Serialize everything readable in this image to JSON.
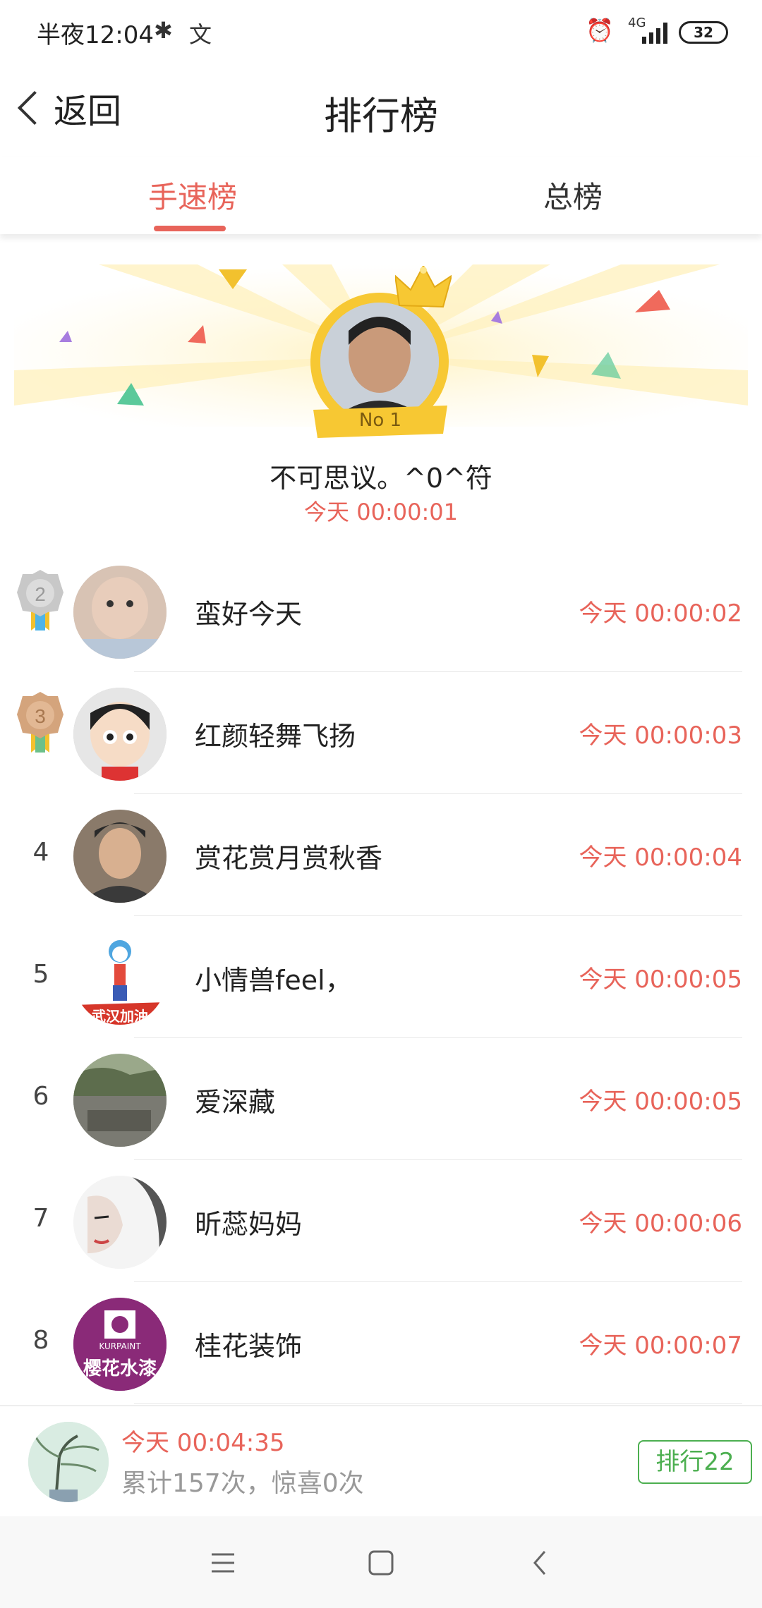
{
  "status_bar": {
    "time": "半夜12:04",
    "network": "4G",
    "battery": "32",
    "icons": [
      "bluetooth-icon",
      "app-notification-icon",
      "alarm-icon",
      "signal-icon",
      "battery-icon"
    ]
  },
  "header": {
    "back_label": "返回",
    "title": "排行榜"
  },
  "tabs": [
    {
      "label": "手速榜",
      "active": true
    },
    {
      "label": "总榜",
      "active": false
    }
  ],
  "winner": {
    "badge": "No 1",
    "name": "不可思议。^0^符",
    "time": "今天 00:00:01"
  },
  "rows": [
    {
      "rank": "2",
      "medal": "silver",
      "name": "蛮好今天",
      "time": "今天 00:00:02"
    },
    {
      "rank": "3",
      "medal": "bronze",
      "name": "红颜轻舞飞扬",
      "time": "今天 00:00:03"
    },
    {
      "rank": "4",
      "name": "赏花赏月赏秋香",
      "time": "今天 00:00:04"
    },
    {
      "rank": "5",
      "name": "小情兽feel，",
      "time": "今天 00:00:05",
      "avatar_text": "武汉加油"
    },
    {
      "rank": "6",
      "name": "爱深藏",
      "time": "今天 00:00:05"
    },
    {
      "rank": "7",
      "name": "昕蕊妈妈",
      "time": "今天 00:00:06"
    },
    {
      "rank": "8",
      "name": "桂花装饰",
      "time": "今天 00:00:07",
      "avatar_text": "樱花水漆",
      "avatar_brand": "KURPAINT"
    }
  ],
  "my_rank": {
    "time": "今天 00:04:35",
    "stats": "累计157次，惊喜0次",
    "rank_button": "排行22"
  },
  "colors": {
    "accent": "#e8645a",
    "green": "#4caf50",
    "gold": "#f7c833"
  }
}
